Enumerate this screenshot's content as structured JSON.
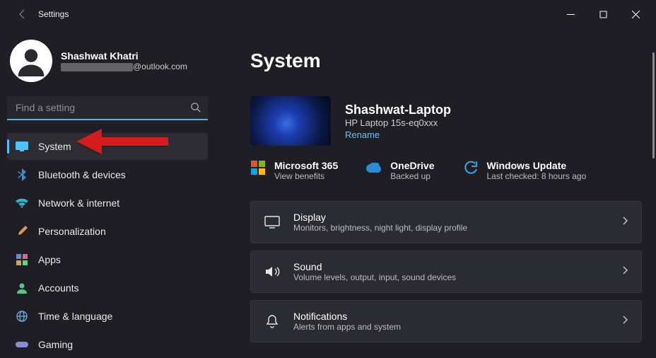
{
  "titlebar": {
    "app_title": "Settings"
  },
  "user": {
    "name": "Shashwat Khatri",
    "email_suffix": "@outlook.com"
  },
  "search": {
    "placeholder": "Find a setting"
  },
  "sidebar": {
    "items": [
      {
        "label": "System"
      },
      {
        "label": "Bluetooth & devices"
      },
      {
        "label": "Network & internet"
      },
      {
        "label": "Personalization"
      },
      {
        "label": "Apps"
      },
      {
        "label": "Accounts"
      },
      {
        "label": "Time & language"
      },
      {
        "label": "Gaming"
      }
    ]
  },
  "main": {
    "title": "System",
    "device": {
      "name": "Shashwat-Laptop",
      "model": "HP Laptop 15s-eq0xxx",
      "rename": "Rename"
    },
    "status": {
      "ms365": {
        "title": "Microsoft 365",
        "sub": "View benefits"
      },
      "onedrive": {
        "title": "OneDrive",
        "sub": "Backed up"
      },
      "update": {
        "title": "Windows Update",
        "sub": "Last checked: 8 hours ago"
      }
    },
    "cards": [
      {
        "title": "Display",
        "sub": "Monitors, brightness, night light, display profile"
      },
      {
        "title": "Sound",
        "sub": "Volume levels, output, input, sound devices"
      },
      {
        "title": "Notifications",
        "sub": "Alerts from apps and system"
      }
    ]
  }
}
